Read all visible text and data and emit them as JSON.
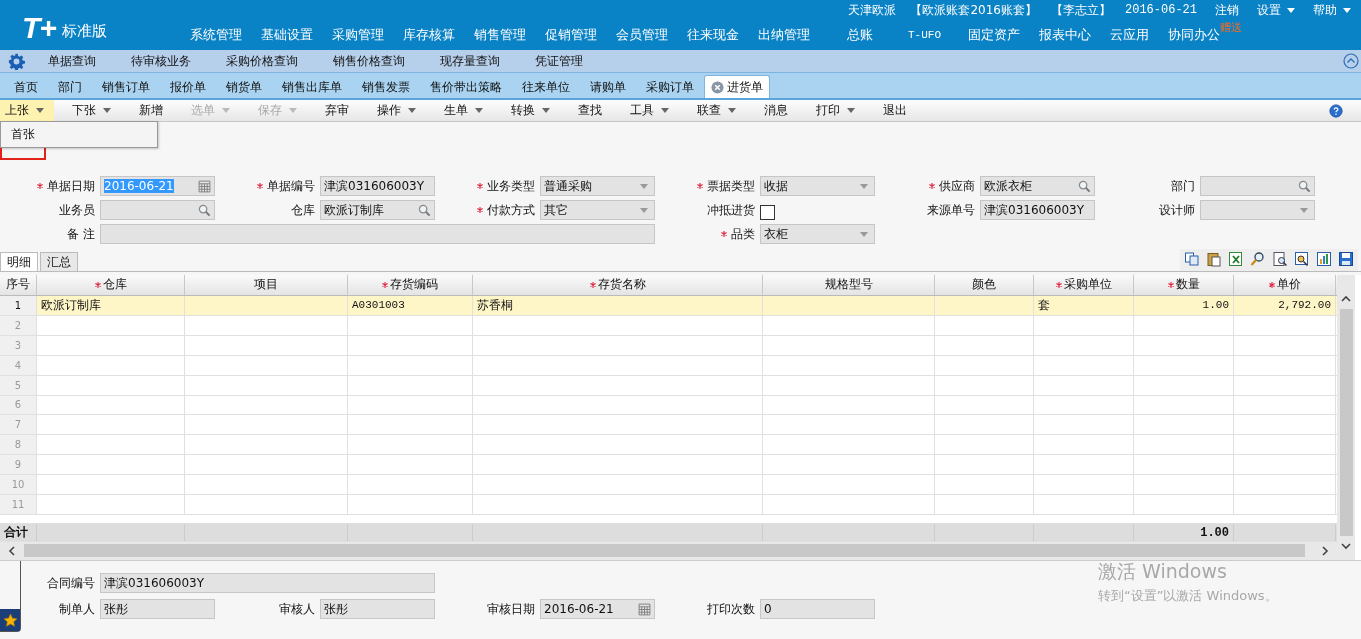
{
  "logo": {
    "mark": "T+",
    "edition": "标准版"
  },
  "header_info": {
    "company": "天津欧派",
    "account": "【欧派账套2016账套】",
    "user": "【李志立】",
    "date": "2016-06-21",
    "links": [
      {
        "label": "注销",
        "dropdown": false
      },
      {
        "label": "设置",
        "dropdown": true
      },
      {
        "label": "帮助",
        "dropdown": true
      }
    ]
  },
  "main_menu": [
    {
      "label": "系统管理"
    },
    {
      "label": "基础设置"
    },
    {
      "label": "采购管理"
    },
    {
      "label": "库存核算"
    },
    {
      "label": "销售管理"
    },
    {
      "label": "促销管理"
    },
    {
      "label": "会员管理"
    },
    {
      "label": "往来现金"
    },
    {
      "label": "出纳管理"
    },
    {
      "label": "总账"
    },
    {
      "label": "T-UFO"
    },
    {
      "label": "固定资产"
    },
    {
      "label": "报表中心"
    },
    {
      "label": "云应用"
    },
    {
      "label": "协同办公",
      "badge": "赠送"
    }
  ],
  "quick_bar": [
    "单据查询",
    "待审核业务",
    "采购价格查询",
    "销售价格查询",
    "现存量查询",
    "凭证管理"
  ],
  "tabs": [
    {
      "label": "首页",
      "selected": false,
      "closable": false
    },
    {
      "label": "部门",
      "selected": false,
      "closable": false
    },
    {
      "label": "销售订单",
      "selected": false,
      "closable": false
    },
    {
      "label": "报价单",
      "selected": false,
      "closable": false
    },
    {
      "label": "销货单",
      "selected": false,
      "closable": false
    },
    {
      "label": "销售出库单",
      "selected": false,
      "closable": false
    },
    {
      "label": "销售发票",
      "selected": false,
      "closable": false
    },
    {
      "label": "售价带出策略",
      "selected": false,
      "closable": false
    },
    {
      "label": "往来单位",
      "selected": false,
      "closable": false
    },
    {
      "label": "请购单",
      "selected": false,
      "closable": false
    },
    {
      "label": "采购订单",
      "selected": false,
      "closable": false
    },
    {
      "label": "进货单",
      "selected": true,
      "closable": true
    }
  ],
  "toolbar": [
    {
      "label": "上张",
      "dropdown": true,
      "disabled": false,
      "open": true
    },
    {
      "label": "下张",
      "dropdown": true,
      "disabled": false,
      "open": false
    },
    {
      "label": "新增",
      "dropdown": false,
      "disabled": false,
      "open": false
    },
    {
      "label": "选单",
      "dropdown": true,
      "disabled": true,
      "open": false
    },
    {
      "label": "保存",
      "dropdown": true,
      "disabled": true,
      "open": false
    },
    {
      "label": "弃审",
      "dropdown": false,
      "disabled": false,
      "open": false
    },
    {
      "label": "操作",
      "dropdown": true,
      "disabled": false,
      "open": false
    },
    {
      "label": "生单",
      "dropdown": true,
      "disabled": false,
      "open": false
    },
    {
      "label": "转换",
      "dropdown": true,
      "disabled": false,
      "open": false
    },
    {
      "label": "查找",
      "dropdown": false,
      "disabled": false,
      "open": false
    },
    {
      "label": "工具",
      "dropdown": true,
      "disabled": false,
      "open": false
    },
    {
      "label": "联查",
      "dropdown": true,
      "disabled": false,
      "open": false
    },
    {
      "label": "消息",
      "dropdown": false,
      "disabled": false,
      "open": false
    },
    {
      "label": "打印",
      "dropdown": true,
      "disabled": false,
      "open": false
    },
    {
      "label": "退出",
      "dropdown": false,
      "disabled": false,
      "open": false
    }
  ],
  "dropdown_menu": [
    "首张"
  ],
  "form": [
    [
      {
        "label": "单据日期",
        "required": true,
        "kind": "date",
        "value": "2016-06-21"
      },
      {
        "label": "单据编号",
        "required": true,
        "kind": "text",
        "value": "津滨031606003Y"
      },
      {
        "label": "业务类型",
        "required": true,
        "kind": "select",
        "value": "普通采购"
      },
      {
        "label": "票据类型",
        "required": true,
        "kind": "select",
        "value": "收据"
      },
      {
        "label": "供应商",
        "required": true,
        "kind": "lookup",
        "value": "欧派衣柜"
      },
      {
        "label": "部门",
        "required": false,
        "kind": "lookup"
      }
    ],
    [
      {
        "label": "业务员",
        "required": false,
        "kind": "lookup"
      },
      {
        "label": "仓库",
        "required": false,
        "kind": "lookup",
        "value": "欧派订制库"
      },
      {
        "label": "付款方式",
        "required": true,
        "kind": "select",
        "value": "其它"
      },
      {
        "label": "冲抵进货",
        "required": false,
        "kind": "checkbox",
        "checked": false
      },
      {
        "label": "来源单号",
        "required": false,
        "kind": "text",
        "value": "津滨031606003Y"
      },
      {
        "label": "设计师",
        "required": false,
        "kind": "select"
      }
    ],
    [
      {
        "label": "备 注",
        "required": false,
        "kind": "memo"
      },
      {
        "label": "品类",
        "required": true,
        "kind": "select",
        "value": "衣柜"
      }
    ]
  ],
  "detail_tabs": [
    {
      "label": "明细",
      "selected": true
    },
    {
      "label": "汇总",
      "selected": false
    }
  ],
  "table": {
    "columns": [
      {
        "label": "序号",
        "required": false
      },
      {
        "label": "仓库",
        "required": true
      },
      {
        "label": "项目",
        "required": false
      },
      {
        "label": "存货编码",
        "required": true
      },
      {
        "label": "存货名称",
        "required": true
      },
      {
        "label": "规格型号",
        "required": false
      },
      {
        "label": "颜色",
        "required": false
      },
      {
        "label": "采购单位",
        "required": true
      },
      {
        "label": "数量",
        "required": true
      },
      {
        "label": "单价",
        "required": true
      }
    ],
    "rows": [
      {
        "no": "1",
        "selected": true,
        "warehouse": "欧派订制库",
        "code": "A0301003",
        "name": "苏香桐",
        "unit": "套",
        "qty": "1.00",
        "price": "2,792.00"
      },
      {
        "no": "2",
        "selected": false
      },
      {
        "no": "3",
        "selected": false
      },
      {
        "no": "4",
        "selected": false
      },
      {
        "no": "5",
        "selected": false
      },
      {
        "no": "6",
        "selected": false
      },
      {
        "no": "7",
        "selected": false
      },
      {
        "no": "8",
        "selected": false
      },
      {
        "no": "9",
        "selected": false
      },
      {
        "no": "10",
        "selected": false
      },
      {
        "no": "11",
        "selected": false
      }
    ],
    "total": {
      "label": "合计",
      "qty": "1.00"
    }
  },
  "footer_form": [
    [
      {
        "label": "合同编号",
        "kind": "memo",
        "value": "津滨031606003Y"
      }
    ],
    [
      {
        "label": "制单人",
        "kind": "text",
        "value": "张彤"
      },
      {
        "label": "审核人",
        "kind": "text",
        "value": "张彤"
      },
      {
        "label": "审核日期",
        "kind": "date",
        "value": "2016-06-21"
      },
      {
        "label": "打印次数",
        "kind": "text",
        "value": "0"
      }
    ]
  ],
  "activation_notice": {
    "title": "激活 Windows",
    "text": "转到“设置”以激活 Windows。"
  }
}
